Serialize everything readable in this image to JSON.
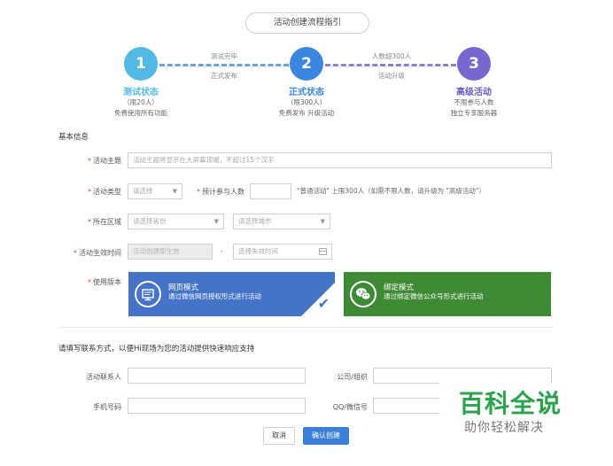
{
  "header": {
    "guide_button": "活动创建流程指引"
  },
  "steps": [
    {
      "number": "1",
      "title": "测试状态",
      "limit": "（限20人）",
      "desc": "免费使用所有功能",
      "color": "#52b9e6"
    },
    {
      "number": "2",
      "title": "正式状态",
      "limit": "（限300人）",
      "desc": "免费发布  升级活动",
      "color": "#3a86e0"
    },
    {
      "number": "3",
      "title": "高级活动",
      "limit": "不限参与人数",
      "desc": "独立专享服务器",
      "color": "#7a66cf"
    }
  ],
  "connectors": [
    {
      "top": "测试完毕",
      "bottom": "正式发布"
    },
    {
      "top": "人数超300人",
      "bottom": "活动升级"
    }
  ],
  "basic_info": {
    "section_title": "基本信息",
    "theme": {
      "label": "活动主题",
      "placeholder": "活动主题将显示在大屏幕顶端，不超过15个汉字"
    },
    "type": {
      "label": "活动类型",
      "value": "请选择"
    },
    "expected": {
      "label": "预计参与人数",
      "hint": "\"普通活动\" 上限300人（如需不限人数，请升级为 \"高级活动\"）"
    },
    "region": {
      "label": "所在区域",
      "province": "请选择省份",
      "city": "请选择城市"
    },
    "effective_time": {
      "label": "活动生效时间",
      "start": "活动创建即生效",
      "separator": "-",
      "end": "选择失效时间"
    },
    "version": {
      "label": "使用版本",
      "web_mode": {
        "title": "网页模式",
        "desc": "通过微信网页授权形式进行活动"
      },
      "bind_mode": {
        "title": "绑定模式",
        "desc": "通过绑定微信公众号形式进行活动"
      }
    }
  },
  "contact": {
    "section_title": "请填写联系方式，以便Hi现场为您的活动提供快速响应支持",
    "contact_person": "活动联系人",
    "company": "公司/组织",
    "phone": "手机号码",
    "qq": "QQ/微信号"
  },
  "actions": {
    "cancel": "取消",
    "confirm": "确认创建"
  },
  "watermark": {
    "main": "百科全说",
    "sub": "助你轻松解决"
  },
  "colors": {
    "web_mode": "#4473c8",
    "bind_mode": "#3f8a35",
    "primary": "#3a80d8",
    "required": "#e0453a",
    "watermark": "#2ba24c"
  }
}
